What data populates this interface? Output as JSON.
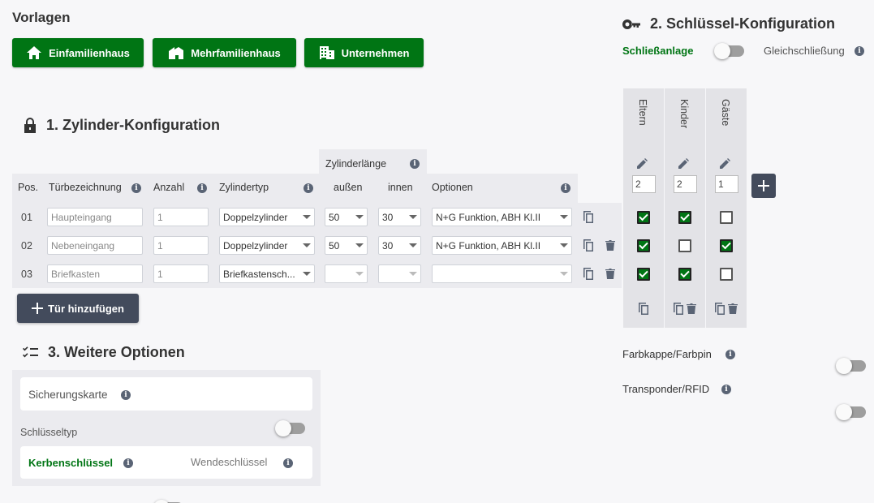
{
  "templates": {
    "title": "Vorlagen",
    "buttons": [
      "Einfamilienhaus",
      "Mehrfamilienhaus",
      "Unternehmen"
    ]
  },
  "cylinder_section": {
    "title": "1. Zylinder-Konfiguration",
    "headers": {
      "pos": "Pos.",
      "door": "Türbezeichnung",
      "count": "Anzahl",
      "type": "Zylindertyp",
      "length_group": "Zylinderlänge",
      "outer": "außen",
      "inner": "innen",
      "options": "Optionen"
    },
    "rows": [
      {
        "pos": "01",
        "door_placeholder": "Haupteingang",
        "count_placeholder": "1",
        "type": "Doppelzylinder",
        "outer": "50",
        "inner": "30",
        "options": "N+G Funktion, ABH Kl.II",
        "deletable": false
      },
      {
        "pos": "02",
        "door_placeholder": "Nebeneingang",
        "count_placeholder": "1",
        "type": "Doppelzylinder",
        "outer": "50",
        "inner": "30",
        "options": "N+G Funktion, ABH Kl.II",
        "deletable": true
      },
      {
        "pos": "03",
        "door_placeholder": "Briefkasten",
        "count_placeholder": "1",
        "type": "Briefkastensch...",
        "outer": "",
        "inner": "",
        "options": "",
        "deletable": true
      }
    ],
    "add_door_label": "Tür hinzufügen"
  },
  "key_section": {
    "title": "2. Schlüssel-Konfiguration",
    "mode_active": "Schließanlage",
    "mode_inactive": "Gleichschließung",
    "columns": [
      {
        "name": "Eltern",
        "quantity": "2"
      },
      {
        "name": "Kinder",
        "quantity": "2"
      },
      {
        "name": "Gäste",
        "quantity": "1"
      }
    ],
    "matrix": [
      [
        true,
        true,
        false
      ],
      [
        true,
        false,
        true
      ],
      [
        true,
        true,
        false
      ]
    ],
    "options": [
      {
        "label": "Farbkappe/Farbpin",
        "enabled": false
      },
      {
        "label": "Transponder/RFID",
        "enabled": false
      }
    ]
  },
  "more_options": {
    "title": "3. Weitere Optionen",
    "security_card_label": "Sicherungskarte",
    "security_card_enabled": false,
    "key_type_label": "Schlüsseltyp",
    "key_type_active": "Kerbenschlüssel",
    "key_type_inactive": "Wendeschlüssel"
  },
  "colors": {
    "primary_green": "#007514",
    "dark_button": "#434b5c",
    "panel_bg": "#ebebef"
  }
}
